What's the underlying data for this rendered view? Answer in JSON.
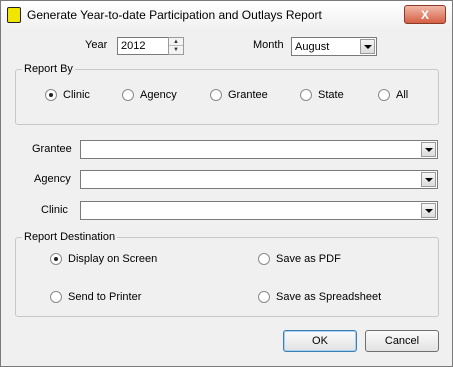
{
  "window": {
    "title": "Generate Year-to-date Participation and Outlays Report",
    "close_glyph": "X"
  },
  "year": {
    "label": "Year",
    "value": "2012"
  },
  "month": {
    "label": "Month",
    "value": "August"
  },
  "report_by": {
    "label": "Report By",
    "options": [
      "Clinic",
      "Agency",
      "Grantee",
      "State",
      "All"
    ],
    "selected": "Clinic"
  },
  "filters": {
    "grantee_label": "Grantee",
    "agency_label": "Agency",
    "clinic_label": "Clinic",
    "grantee_value": "",
    "agency_value": "",
    "clinic_value": ""
  },
  "destination": {
    "label": "Report Destination",
    "options": [
      "Display on Screen",
      "Save as PDF",
      "Send to Printer",
      "Save as Spreadsheet"
    ],
    "selected": "Display on Screen"
  },
  "buttons": {
    "ok": "OK",
    "cancel": "Cancel"
  },
  "icons": {
    "app": "report-app-icon",
    "close": "close-icon",
    "dropdown": "chevron-down-icon",
    "spinner": "spinner-arrows-icon"
  }
}
